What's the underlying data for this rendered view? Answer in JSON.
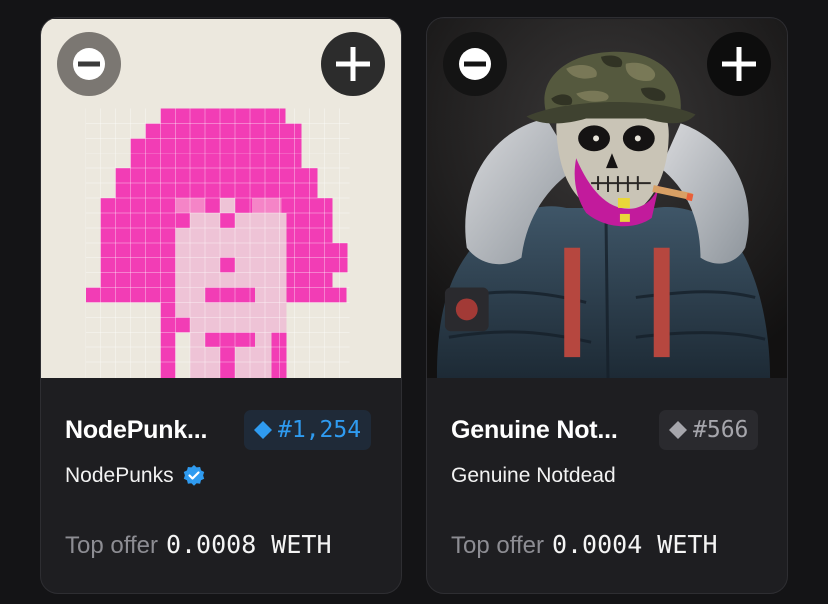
{
  "cards": [
    {
      "name": "NodePunk...",
      "token_id": "#1,254",
      "collection": "NodePunks",
      "verified": true,
      "offer_label": "Top offer",
      "offer_value": "0.0008 WETH",
      "badge_color": "#2f9bf0",
      "art_background": "#ece8de",
      "art_primary": "#f23db5",
      "art_skin": "#eec3d6",
      "icons": [
        "remove-icon",
        "add-icon",
        "diamond-icon",
        "verified-icon"
      ]
    },
    {
      "name": "Genuine Not...",
      "token_id": "#566",
      "collection": "Genuine Notdead",
      "verified": false,
      "offer_label": "Top offer",
      "offer_value": "0.0004 WETH",
      "badge_color": "#a6a6ac",
      "art_background": "#1c1b1b",
      "icons": [
        "remove-icon",
        "add-icon",
        "diamond-icon"
      ]
    }
  ]
}
